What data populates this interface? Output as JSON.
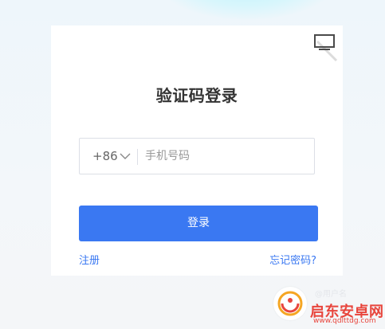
{
  "login_card": {
    "title": "验证码登录",
    "country_code": "+86",
    "phone_placeholder": "手机号码",
    "login_button": "登录",
    "register_link": "注册",
    "forgot_link": "忘记密码?"
  },
  "watermark": {
    "title": "启东安卓网",
    "url": "www.qdlttdg.com",
    "faint_text": "@用户名"
  },
  "colors": {
    "accent": "#3a78f2",
    "watermark_red": "#e8453c",
    "watermark_orange": "#f5a623"
  },
  "icons": {
    "qr_toggle": "monitor-icon",
    "country_code_dropdown": "chevron-down-icon",
    "watermark_logo": "logo-icon"
  }
}
